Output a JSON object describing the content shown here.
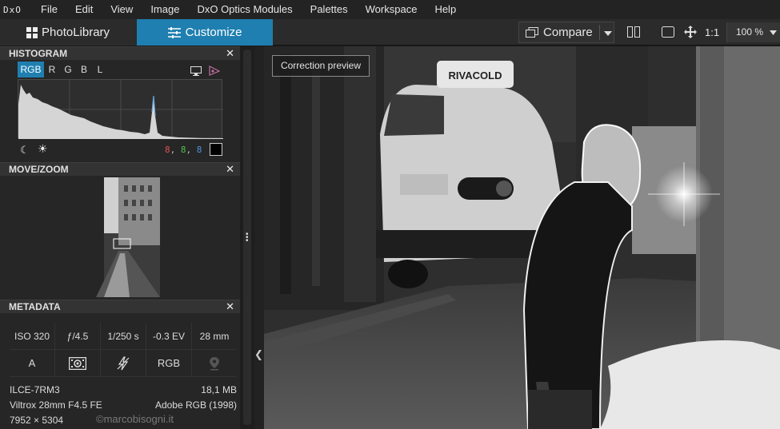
{
  "app": {
    "logo": "DxO"
  },
  "menu": [
    "File",
    "Edit",
    "View",
    "Image",
    "DxO Optics Modules",
    "Palettes",
    "Workspace",
    "Help"
  ],
  "tabs": {
    "library": "PhotoLibrary",
    "customize": "Customize"
  },
  "toolbar": {
    "compare": "Compare",
    "ratio": "1:1",
    "zoom": "100 %"
  },
  "colors": {
    "accent": "#1f7fb0",
    "menu_bg": "#232323",
    "panel_bg": "#262626"
  },
  "histogram": {
    "title": "HISTOGRAM",
    "channels": [
      "RGB",
      "R",
      "G",
      "B",
      "L"
    ],
    "active_channel": "RGB",
    "readout": {
      "r": "8",
      "g": "8",
      "b": "8"
    }
  },
  "movezoom": {
    "title": "MOVE/ZOOM"
  },
  "metadata": {
    "title": "METADATA",
    "iso": "ISO 320",
    "aperture": "ƒ/4.5",
    "shutter": "1/250 s",
    "ev": "-0.3 EV",
    "focal": "28 mm",
    "mode": "A",
    "colorspace_short": "RGB",
    "camera": "ILCE-7RM3",
    "filesize": "18,1 MB",
    "lens": "Viltrox 28mm F4.5 FE",
    "colorspace": "Adobe RGB (1998)",
    "dimensions": "7952 × 5304"
  },
  "viewer": {
    "correction_preview": "Correction preview",
    "van_brand": "RIVACOLD"
  },
  "watermark": "©marcobisogni.it"
}
